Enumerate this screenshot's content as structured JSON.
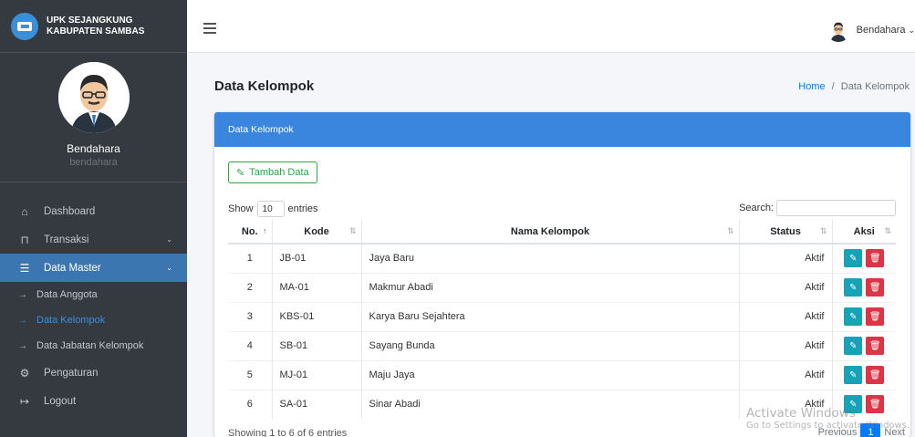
{
  "brand": {
    "line1": "UPK SEJANGKUNG",
    "line2": "KABUPATEN SAMBAS"
  },
  "user": {
    "name": "Bendahara",
    "username": "bendahara"
  },
  "nav": {
    "dashboard": "Dashboard",
    "transaksi": "Transaksi",
    "data_master": "Data Master",
    "sub": [
      "Data Anggota",
      "Data Kelompok",
      "Data Jabatan Kelompok"
    ],
    "pengaturan": "Pengaturan",
    "logout": "Logout"
  },
  "topbar": {
    "user_label": "Bendahara"
  },
  "page": {
    "title": "Data Kelompok",
    "breadcrumb_home": "Home",
    "breadcrumb_sep": "/",
    "breadcrumb_current": "Data Kelompok"
  },
  "card": {
    "header": "Data Kelompok",
    "add_button": "Tambah Data",
    "show_label": "Show",
    "show_value": "10",
    "entries_label": "entries",
    "search_label": "Search:"
  },
  "table": {
    "columns": [
      "No.",
      "Kode",
      "Nama Kelompok",
      "Status",
      "Aksi"
    ],
    "rows": [
      {
        "no": "1",
        "kode": "JB-01",
        "nama": "Jaya Baru",
        "status": "Aktif"
      },
      {
        "no": "2",
        "kode": "MA-01",
        "nama": "Makmur Abadi",
        "status": "Aktif"
      },
      {
        "no": "3",
        "kode": "KBS-01",
        "nama": "Karya Baru Sejahtera",
        "status": "Aktif"
      },
      {
        "no": "4",
        "kode": "SB-01",
        "nama": "Sayang Bunda",
        "status": "Aktif"
      },
      {
        "no": "5",
        "kode": "MJ-01",
        "nama": "Maju Jaya",
        "status": "Aktif"
      },
      {
        "no": "6",
        "kode": "SA-01",
        "nama": "Sinar Abadi",
        "status": "Aktif"
      }
    ]
  },
  "footer": {
    "showing": "Showing 1 to 6 of 6 entries",
    "previous": "Previous",
    "page": "1",
    "next": "Next"
  },
  "watermark": {
    "line1": "Activate Windows",
    "line2": "Go to Settings to activate Windows."
  },
  "colors": {
    "sidebar": "#343a40",
    "primary": "#3a86de",
    "success": "#28a745",
    "info": "#17a2b8",
    "danger": "#dc3545"
  }
}
